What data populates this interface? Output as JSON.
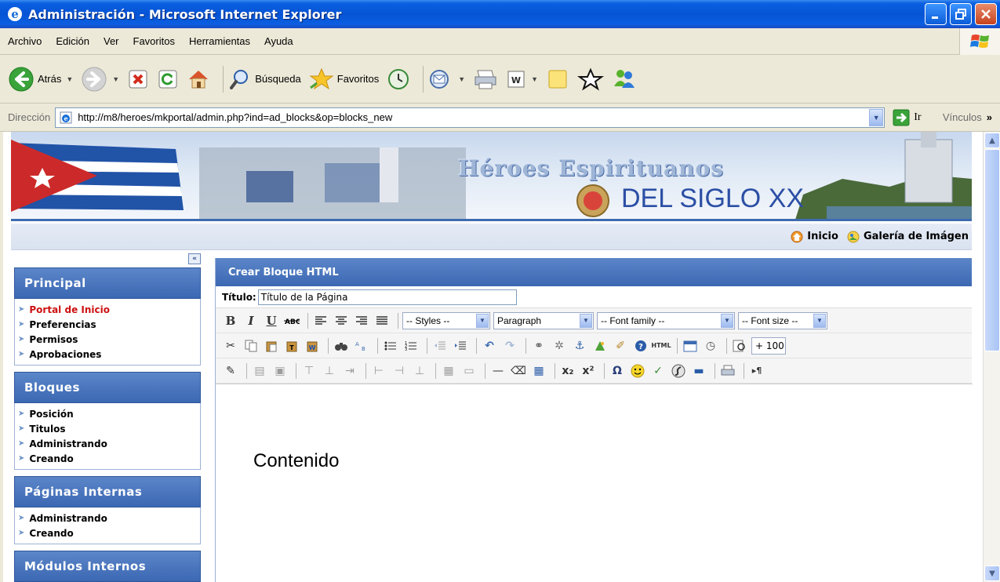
{
  "window": {
    "title": "Administración - Microsoft Internet Explorer",
    "app_icon": "ie-icon",
    "buttons": [
      "minimize",
      "maximize",
      "close"
    ]
  },
  "menu": [
    "Archivo",
    "Edición",
    "Ver",
    "Favoritos",
    "Herramientas",
    "Ayuda"
  ],
  "toolbar": {
    "back_label": "Atrás",
    "search_label": "Búsqueda",
    "favorites_label": "Favoritos"
  },
  "address": {
    "label": "Dirección",
    "url": "http://m8/heroes/mkportal/admin.php?ind=ad_blocks&op=blocks_new",
    "go_label": "Ir",
    "links_label": "Vínculos",
    "links_more": "»"
  },
  "banner": {
    "title": "Héroes Espirituanos",
    "subtitle": "DEL SIGLO XX"
  },
  "nav": {
    "home": "Inicio",
    "gallery": "Galería de Imágen"
  },
  "sidebar": {
    "collapse_label": "«",
    "sections": [
      {
        "title": "Principal",
        "items": [
          {
            "label": "Portal de Inicio",
            "active": true
          },
          {
            "label": "Preferencias",
            "active": false
          },
          {
            "label": "Permisos",
            "active": false
          },
          {
            "label": "Aprobaciones",
            "active": false
          }
        ]
      },
      {
        "title": "Bloques",
        "items": [
          {
            "label": "Posición",
            "active": false
          },
          {
            "label": "Titulos",
            "active": false
          },
          {
            "label": "Administrando",
            "active": false
          },
          {
            "label": "Creando",
            "active": false
          }
        ]
      },
      {
        "title": "Páginas Internas",
        "items": [
          {
            "label": "Administrando",
            "active": false
          },
          {
            "label": "Creando",
            "active": false
          }
        ]
      },
      {
        "title": "Módulos Internos",
        "items": []
      }
    ]
  },
  "main": {
    "heading": "Crear Bloque HTML",
    "title_label": "Título:",
    "title_value": "Título de la Página",
    "editor": {
      "styles": "-- Styles --",
      "format": "Paragraph",
      "font_family": "-- Font family --",
      "font_size": "-- Font size --",
      "zoom": "+ 100",
      "html_label": "HTML",
      "content": "Contenido"
    }
  },
  "colors": {
    "titlebar": "#0654d6",
    "section_header": "#3c68b3",
    "active_item": "#cc1111",
    "banner_subtitle": "#2c4fa5"
  }
}
